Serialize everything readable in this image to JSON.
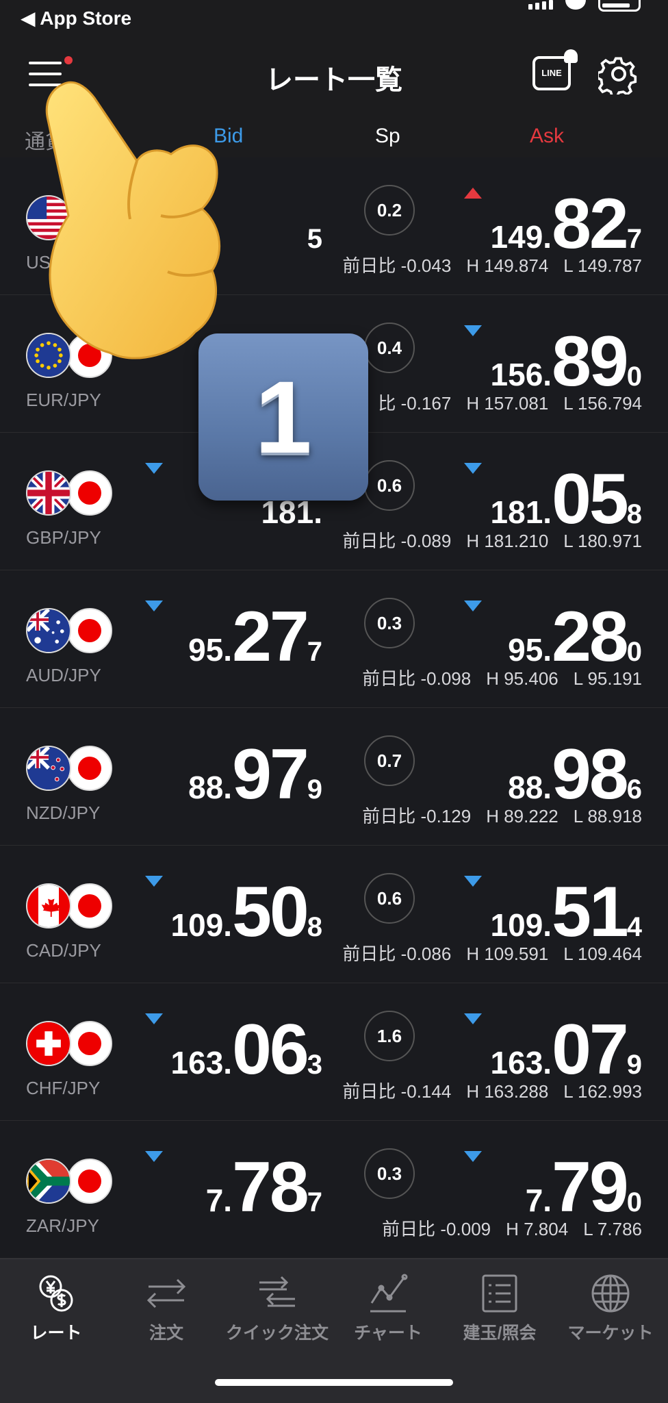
{
  "status_bar": {
    "back_label": "◀ App Store"
  },
  "nav": {
    "title": "レート一覧",
    "line_label": "LINE"
  },
  "columns": {
    "pair": "通貨ペ",
    "bid": "Bid",
    "spread": "Sp",
    "ask": "Ask"
  },
  "overlay": {
    "step_number": "1"
  },
  "colors": {
    "accent_blue": "#3d9be9",
    "ask_red": "#e5393f",
    "background": "#1c1c1e"
  },
  "rows": [
    {
      "pair": "USD/JPY",
      "bid": {
        "head": "",
        "big": "",
        "tail": "5"
      },
      "spread": "0.2",
      "ask": {
        "head": "149.",
        "big": "82",
        "tail": "7"
      },
      "change": "前日比 -0.043",
      "high": "H 149.874",
      "low": "L 149.787",
      "bid_dir": "",
      "ask_dir": "up"
    },
    {
      "pair": "EUR/JPY",
      "bid": {
        "head": "",
        "big": "",
        "tail": ""
      },
      "spread": "0.4",
      "ask": {
        "head": "156.",
        "big": "89",
        "tail": "0"
      },
      "change": "比 -0.167",
      "high": "H 157.081",
      "low": "L 156.794",
      "bid_dir": "",
      "ask_dir": "down"
    },
    {
      "pair": "GBP/JPY",
      "bid": {
        "head": "181.",
        "big": "",
        "tail": ""
      },
      "spread": "0.6",
      "ask": {
        "head": "181.",
        "big": "05",
        "tail": "8"
      },
      "change": "前日比 -0.089",
      "high": "H 181.210",
      "low": "L 180.971",
      "bid_dir": "down",
      "ask_dir": "down"
    },
    {
      "pair": "AUD/JPY",
      "bid": {
        "head": "95.",
        "big": "27",
        "tail": "7"
      },
      "spread": "0.3",
      "ask": {
        "head": "95.",
        "big": "28",
        "tail": "0"
      },
      "change": "前日比 -0.098",
      "high": "H 95.406",
      "low": "L 95.191",
      "bid_dir": "down",
      "ask_dir": "down"
    },
    {
      "pair": "NZD/JPY",
      "bid": {
        "head": "88.",
        "big": "97",
        "tail": "9"
      },
      "spread": "0.7",
      "ask": {
        "head": "88.",
        "big": "98",
        "tail": "6"
      },
      "change": "前日比 -0.129",
      "high": "H 89.222",
      "low": "L 88.918",
      "bid_dir": "",
      "ask_dir": ""
    },
    {
      "pair": "CAD/JPY",
      "bid": {
        "head": "109.",
        "big": "50",
        "tail": "8"
      },
      "spread": "0.6",
      "ask": {
        "head": "109.",
        "big": "51",
        "tail": "4"
      },
      "change": "前日比 -0.086",
      "high": "H 109.591",
      "low": "L 109.464",
      "bid_dir": "down",
      "ask_dir": "down"
    },
    {
      "pair": "CHF/JPY",
      "bid": {
        "head": "163.",
        "big": "06",
        "tail": "3"
      },
      "spread": "1.6",
      "ask": {
        "head": "163.",
        "big": "07",
        "tail": "9"
      },
      "change": "前日比 -0.144",
      "high": "H 163.288",
      "low": "L 162.993",
      "bid_dir": "down",
      "ask_dir": "down"
    },
    {
      "pair": "ZAR/JPY",
      "bid": {
        "head": "7.",
        "big": "78",
        "tail": "7"
      },
      "spread": "0.3",
      "ask": {
        "head": "7.",
        "big": "79",
        "tail": "0"
      },
      "change": "前日比 -0.009",
      "high": "H 7.804",
      "low": "L 7.786",
      "bid_dir": "down",
      "ask_dir": "down"
    }
  ],
  "tabs": [
    {
      "label": "レート",
      "icon": "exchange-yen-dollar-icon",
      "active": true
    },
    {
      "label": "注文",
      "icon": "arrows-left-right-icon",
      "active": false
    },
    {
      "label": "クイック注文",
      "icon": "quick-arrows-icon",
      "active": false
    },
    {
      "label": "チャート",
      "icon": "chart-line-icon",
      "active": false
    },
    {
      "label": "建玉/照会",
      "icon": "list-document-icon",
      "active": false
    },
    {
      "label": "マーケット",
      "icon": "globe-icon",
      "active": false
    }
  ]
}
